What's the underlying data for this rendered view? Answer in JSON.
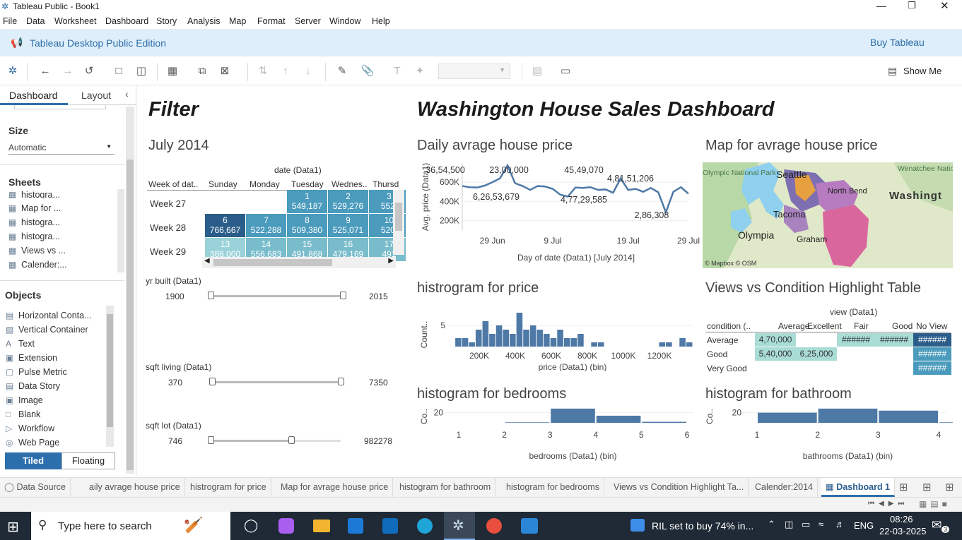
{
  "window": {
    "title": "Tableau Public - Book1"
  },
  "menu": [
    "File",
    "Data",
    "Worksheet",
    "Dashboard",
    "Story",
    "Analysis",
    "Map",
    "Format",
    "Server",
    "Window",
    "Help"
  ],
  "banner": {
    "edition": "Tableau Desktop Public Edition",
    "buy": "Buy Tableau"
  },
  "toolbar": {
    "show_me": "Show Me"
  },
  "left_panel": {
    "tab_dashboard": "Dashboard",
    "tab_layout": "Layout",
    "size_header": "Size",
    "size_value": "Automatic",
    "sheets_header": "Sheets",
    "sheets": [
      "histogra...",
      "Map for ...",
      "histogra...",
      "histogra...",
      "Views vs ...",
      "Calender:..."
    ],
    "objects_header": "Objects",
    "objects": [
      "Horizontal Conta...",
      "Vertical Container",
      "Text",
      "Extension",
      "Pulse Metric",
      "Data Story",
      "Image",
      "Blank",
      "Workflow",
      "Web Page"
    ],
    "tiled": "Tiled",
    "floating": "Floating"
  },
  "dashboard": {
    "filter_title": "Filter",
    "main_title": "Washington House Sales Dashboard",
    "calendar": {
      "title": "July 2014",
      "col_header": "date (Data1)",
      "row_header": "Week of dat..",
      "days": [
        "Sunday",
        "Monday",
        "Tuesday",
        "Wednes..",
        "Thursd"
      ],
      "weeks": [
        "Week 27",
        "Week 28",
        "Week 29"
      ],
      "cells": [
        {
          "day": "1",
          "value": "549,187"
        },
        {
          "day": "2",
          "value": "529,276"
        },
        {
          "day": "3",
          "value": "552,"
        },
        {
          "day": "6",
          "value": "766,667"
        },
        {
          "day": "7",
          "value": "522,288"
        },
        {
          "day": "8",
          "value": "509,380"
        },
        {
          "day": "9",
          "value": "525,071"
        },
        {
          "day": "10",
          "value": "520,"
        },
        {
          "day": "13",
          "value": "388,000"
        },
        {
          "day": "14",
          "value": "556,683"
        },
        {
          "day": "15",
          "value": "491,868"
        },
        {
          "day": "16",
          "value": "479,169"
        },
        {
          "day": "17",
          "value": "491"
        }
      ]
    },
    "filters": [
      {
        "label": "yr built (Data1)",
        "min": "1900",
        "max": "2015",
        "low_pct": 0,
        "high_pct": 100
      },
      {
        "label": "sqft living (Data1)",
        "min": "370",
        "max": "7350",
        "low_pct": 0,
        "high_pct": 100
      },
      {
        "label": "sqft lot (Data1)",
        "min": "746",
        "max": "982278",
        "low_pct": 0,
        "high_pct": 62
      }
    ],
    "line_chart_title": "Daily avrage house price",
    "map_title": "Map for avrage house price",
    "map": {
      "labels": [
        "Seattle",
        "Tacoma",
        "Olympia",
        "Graham",
        "North Bend",
        "Washingt",
        "Wenatchee National Forest",
        "Olympic National Park"
      ],
      "attribution": "© Mapbox © OSM"
    },
    "price_hist_title": "histrogram for price",
    "highlight_title": "Views vs Condition Highlight Table",
    "bedrooms_title": "histogram for bedrooms",
    "bathroom_title": "histogram for bathroom"
  },
  "chart_data": [
    {
      "type": "line",
      "title": "Daily avrage house price",
      "xlabel": "Day of date (Data1) [July 2014]",
      "ylabel": "Avg. price (Data1)",
      "x_ticks": [
        "29 Jun",
        "9 Jul",
        "19 Jul",
        "29 Jul"
      ],
      "y_ticks": [
        "200K",
        "400K",
        "600K"
      ],
      "ylim": [
        100000,
        800000
      ],
      "x": [
        1,
        2,
        3,
        4,
        5,
        6,
        7,
        8,
        9,
        10,
        11,
        12,
        13,
        14,
        15,
        16,
        17,
        18,
        19,
        20,
        21,
        22,
        23,
        24,
        25,
        26,
        27,
        28,
        29,
        30,
        31
      ],
      "y": [
        560000,
        548000,
        545000,
        565000,
        600000,
        640000,
        775000,
        590000,
        560000,
        520000,
        560000,
        555000,
        530000,
        470000,
        450000,
        545000,
        540000,
        548000,
        520000,
        525000,
        490000,
        640000,
        520000,
        530000,
        500000,
        540000,
        495000,
        286000,
        500000,
        548000,
        480000
      ],
      "annotations": [
        "36,54,500",
        "23,00,000",
        "45,49,070",
        "4,81,51,206",
        "6,26,53,679",
        "4,77,29,585",
        "2,86,308"
      ]
    },
    {
      "type": "bar",
      "title": "histrogram for price",
      "xlabel": "price (Data1) (bin)",
      "ylabel": "Count..",
      "x_ticks": [
        "200K",
        "400K",
        "600K",
        "800K",
        "1000K",
        "1200K"
      ],
      "y_ticks": [
        "5"
      ],
      "ylim": [
        0,
        10
      ],
      "values": [
        0,
        2,
        2,
        1,
        4,
        6,
        3,
        5,
        4,
        3,
        8,
        4,
        5,
        4,
        3,
        2,
        4,
        2,
        2,
        3,
        0,
        1,
        1,
        0,
        0,
        0,
        0,
        0,
        0,
        0,
        0,
        1,
        1,
        0,
        2,
        1
      ]
    },
    {
      "type": "table",
      "title": "Views vs Condition Highlight Table",
      "col_header": "view (Data1)",
      "row_header": "condition (..",
      "columns": [
        "Average",
        "Excellent",
        "Fair",
        "Good",
        "No View"
      ],
      "rows": [
        {
          "label": "Average",
          "cells": [
            "4,70,000",
            "",
            "######",
            "######",
            "######"
          ]
        },
        {
          "label": "Good",
          "cells": [
            "5,40,000",
            "6,25,000",
            "",
            "",
            "######"
          ]
        },
        {
          "label": "Very Good",
          "cells": [
            "",
            "",
            "",
            "",
            "######"
          ]
        }
      ]
    },
    {
      "type": "bar",
      "title": "histogram for bedrooms",
      "xlabel": "bedrooms (Data1) (bin)",
      "ylabel": "Co..",
      "categories": [
        "1",
        "2",
        "3",
        "4",
        "5",
        "6"
      ],
      "y_ticks": [
        "20"
      ],
      "ylim": [
        0,
        32
      ],
      "values": [
        0,
        1,
        28,
        14,
        2
      ]
    },
    {
      "type": "bar",
      "title": "histogram for bathroom",
      "xlabel": "bathrooms (Data1) (bin)",
      "ylabel": "Co..",
      "categories": [
        "1",
        "2",
        "3",
        "4"
      ],
      "y_ticks": [
        "20"
      ],
      "ylim": [
        0,
        32
      ],
      "values": [
        20,
        28,
        24,
        1
      ]
    }
  ],
  "tabs": [
    "Data Source",
    "aily avrage house price",
    "histrogram for price",
    "Map for avrage house price",
    "histogram for bathroom",
    "histogram for bedrooms",
    "Views vs Condition Highlight Ta...",
    "Calender:2014",
    "Dashboard 1"
  ],
  "taskbar": {
    "search_placeholder": "Type here to search",
    "news": "RIL set to buy 74% in...",
    "lang": "ENG",
    "time": "08:26",
    "date": "22-03-2025",
    "notif_count": "3"
  },
  "colors": {
    "accent": "#4e79a7",
    "banner_bg": "#deeefb",
    "tiled_bg": "#2c6fad",
    "heat_low": "#99d3d9",
    "heat_high": "#2b5d8a"
  }
}
